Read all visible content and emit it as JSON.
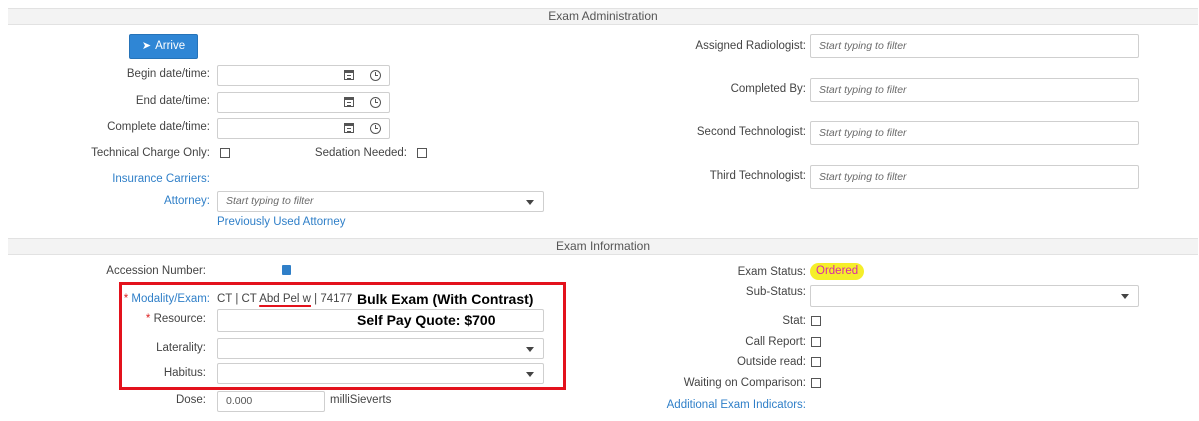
{
  "exam_administration": {
    "section_title": "Exam Administration",
    "arrive_label": "Arrive",
    "begin_datetime_label": "Begin date/time:",
    "end_datetime_label": "End date/time:",
    "complete_datetime_label": "Complete date/time:",
    "technical_charge_label": "Technical Charge Only:",
    "sedation_label": "Sedation Needed:",
    "insurance_carriers_label": "Insurance Carriers:",
    "attorney_label": "Attorney:",
    "attorney_placeholder": "Start typing to filter",
    "previously_used_attorney": "Previously Used Attorney",
    "assigned_radiologist_label": "Assigned Radiologist:",
    "completed_by_label": "Completed By:",
    "second_technologist_label": "Second Technologist:",
    "third_technologist_label": "Third Technologist:",
    "filter_placeholder": "Start typing to filter"
  },
  "exam_information": {
    "section_title": "Exam Information",
    "accession_number_label": "Accession Number:",
    "modality_exam_label": "Modality/Exam:",
    "required_marker": "*",
    "modality_prefix": "CT | CT ",
    "modality_underlined": "Abd Pel w",
    "modality_suffix": " | 74177",
    "resource_label": "Resource:",
    "laterality_label": "Laterality:",
    "habitus_label": "Habitus:",
    "dose_label": "Dose:",
    "dose_value": "0.000",
    "dose_unit": "milliSieverts",
    "exam_status_label": "Exam Status:",
    "exam_status_value": "Ordered",
    "sub_status_label": "Sub-Status:",
    "stat_label": "Stat:",
    "call_report_label": "Call Report:",
    "outside_read_label": "Outside read:",
    "waiting_on_comparison_label": "Waiting on Comparison:",
    "additional_exam_indicators": "Additional Exam Indicators:"
  },
  "annotation": {
    "bulk_exam": "Bulk Exam (With Contrast)",
    "self_pay_quote": "Self Pay Quote: $700"
  },
  "colors": {
    "link": "#2f7fc8",
    "button": "#2f86d5",
    "status_badge_bg": "#f5ee2a",
    "status_badge_text": "#d829a8",
    "annotation_box": "#e3121c"
  }
}
